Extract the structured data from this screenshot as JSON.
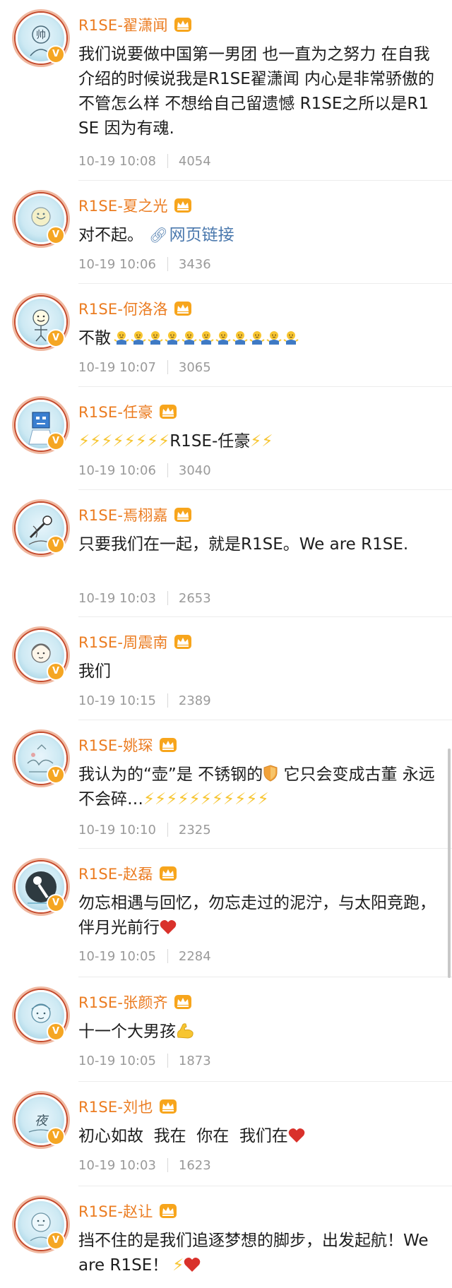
{
  "comments": [
    {
      "name": "R1SE-翟潇闻",
      "text": "我们说要做中国第一男团 也一直为之努力 在自我介绍的时候说我是R1SE翟潇闻 内心是非常骄傲的 不管怎么样 不想给自己留遗憾  R1SE之所以是R1SE 因为有魂.",
      "time": "10-19 10:08",
      "likes": "4054"
    },
    {
      "name": "R1SE-夏之光",
      "text": "对不起。",
      "link_label": "网页链接",
      "time": "10-19 10:06",
      "likes": "3436"
    },
    {
      "name": "R1SE-何洛洛",
      "text": "不散",
      "time": "10-19 10:07",
      "likes": "3065"
    },
    {
      "name": "R1SE-任豪",
      "text_before": "⚡⚡⚡⚡⚡⚡⚡⚡",
      "text": "R1SE-任豪",
      "text_after": "⚡⚡",
      "time": "10-19 10:06",
      "likes": "3040"
    },
    {
      "name": "R1SE-焉栩嘉",
      "text": "只要我们在一起，就是R1SE。We are R1SE.",
      "time": "10-19 10:03",
      "likes": "2653"
    },
    {
      "name": "R1SE-周震南",
      "text": "我们",
      "time": "10-19 10:15",
      "likes": "2389"
    },
    {
      "name": "R1SE-姚琛",
      "text": "我认为的“壶”是 不锈钢的",
      "text_after": " 它只会变成古董 永远不会碎…",
      "bolts": "⚡⚡⚡⚡⚡⚡⚡⚡⚡⚡⚡",
      "time": "10-19 10:10",
      "likes": "2325"
    },
    {
      "name": "R1SE-赵磊",
      "text": "勿忘相遇与回忆，勿忘走过的泥泞，与太阳竞跑，伴月光前行",
      "time": "10-19 10:05",
      "likes": "2284"
    },
    {
      "name": "R1SE-张颜齐",
      "text": "十一个大男孩",
      "time": "10-19 10:05",
      "likes": "1873"
    },
    {
      "name": "R1SE-刘也",
      "text": "初心如故  我在  你在  我们在",
      "time": "10-19 10:03",
      "likes": "1623"
    },
    {
      "name": "R1SE-赵让",
      "text": "挡不住的是我们追逐梦想的脚步，出发起航！We are R1SE！",
      "text_after": "⚡",
      "time": "",
      "likes": ""
    }
  ],
  "colors": {
    "name": "#eb7c21",
    "text": "#1d1d1d",
    "meta": "#9a9a9a",
    "link": "#4a78ad",
    "heart": "#d9312b",
    "bolt": "#f7c531",
    "verified": "#f5a623"
  },
  "icons": {
    "verified": "verified-v-badge-icon",
    "vip": "vip-crown-icon",
    "link": "link-icon",
    "bolt": "lightning-bolt-emoji",
    "heart": "red-heart-emoji",
    "shield": "shield-emoji",
    "muscle": "flexed-biceps-emoji",
    "shrug": "shrug-emoji"
  },
  "shrug_count": 11
}
